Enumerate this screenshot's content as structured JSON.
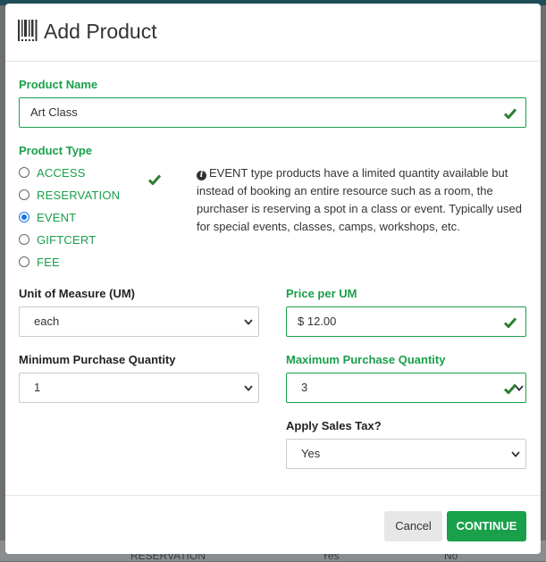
{
  "background": {
    "row_type": "RESERVATION",
    "row_col2": "Yes",
    "row_col3": "No"
  },
  "modal": {
    "title": "Add Product",
    "title_icon": "barcode-icon"
  },
  "product_name": {
    "label": "Product Name",
    "value": "Art Class"
  },
  "product_type": {
    "label": "Product Type",
    "options": [
      {
        "label": "ACCESS",
        "selected": false
      },
      {
        "label": "RESERVATION",
        "selected": false
      },
      {
        "label": "EVENT",
        "selected": true
      },
      {
        "label": "GIFTCERT",
        "selected": false
      },
      {
        "label": "FEE",
        "selected": false
      }
    ],
    "info_text": "EVENT type products have a limited quantity available but instead of booking an entire resource such as a room, the purchaser is reserving a spot in a class or event. Typically used for special events, classes, camps, workshops, etc."
  },
  "unit_of_measure": {
    "label": "Unit of Measure (UM)",
    "value": "each"
  },
  "price_per_um": {
    "label": "Price per UM",
    "value": "$ 12.00"
  },
  "min_qty": {
    "label": "Minimum Purchase Quantity",
    "value": "1"
  },
  "max_qty": {
    "label": "Maximum Purchase Quantity",
    "value": "3"
  },
  "sales_tax": {
    "label": "Apply Sales Tax?",
    "value": "Yes"
  },
  "footer": {
    "cancel_label": "Cancel",
    "continue_label": "CONTINUE"
  },
  "colors": {
    "accent_green": "#19a04a",
    "check_green": "#2e7d32",
    "radio_blue": "#1a73e8"
  }
}
